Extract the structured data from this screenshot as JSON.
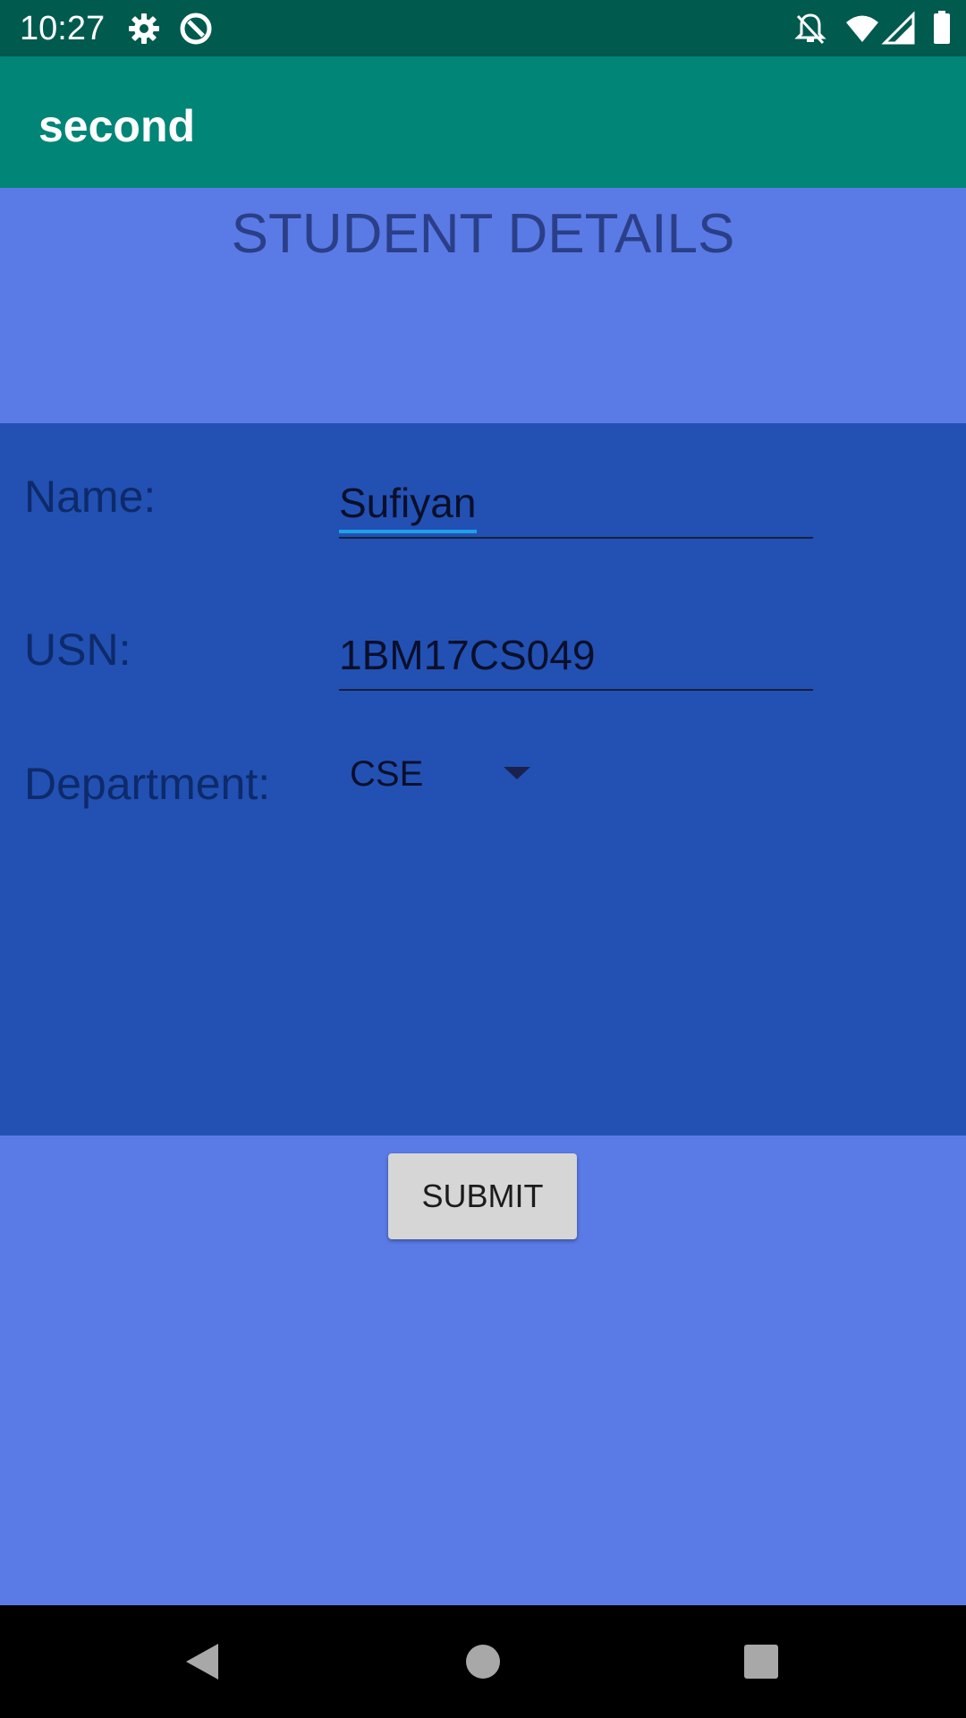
{
  "status_bar": {
    "time": "10:27",
    "icons": [
      "gear-icon",
      "data-saver-icon",
      "notifications-off-icon",
      "wifi-icon",
      "signal-icon",
      "battery-icon"
    ]
  },
  "app_bar": {
    "title": "second",
    "color": "#008577"
  },
  "header": {
    "title": "STUDENT DETAILS"
  },
  "form": {
    "name_label": "Name:",
    "name_value": "Sufiyan",
    "usn_label": "USN:",
    "usn_value": "1BM17CS049",
    "department_label": "Department:",
    "department_value": "CSE"
  },
  "submit": {
    "label": "SUBMIT"
  },
  "colors": {
    "background": "#5a7be6",
    "form_background": "#2251b3",
    "status_bar": "#005a4e"
  },
  "nav_bar": {
    "icons": [
      "back-icon",
      "home-icon",
      "recents-icon"
    ]
  }
}
